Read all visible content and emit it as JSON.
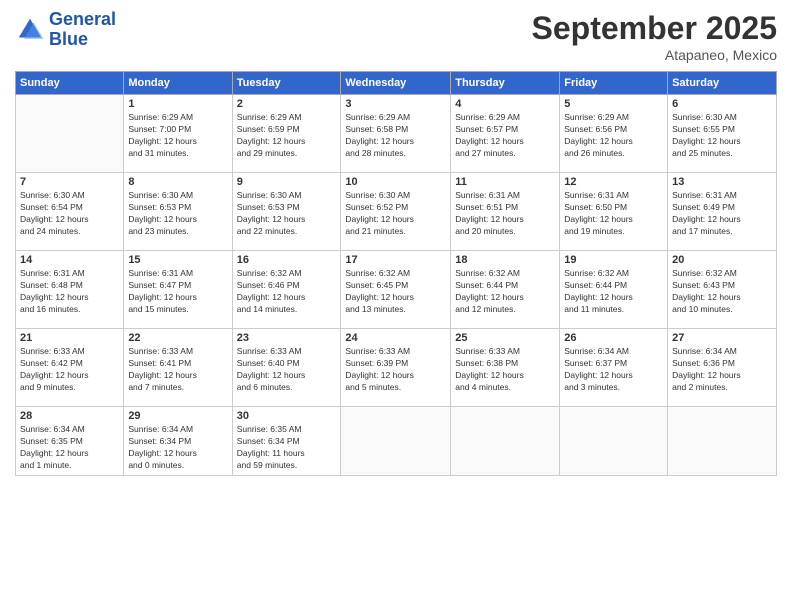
{
  "logo": {
    "line1": "General",
    "line2": "Blue"
  },
  "title": "September 2025",
  "subtitle": "Atapaneo, Mexico",
  "days_of_week": [
    "Sunday",
    "Monday",
    "Tuesday",
    "Wednesday",
    "Thursday",
    "Friday",
    "Saturday"
  ],
  "weeks": [
    [
      {
        "day": "",
        "info": ""
      },
      {
        "day": "1",
        "info": "Sunrise: 6:29 AM\nSunset: 7:00 PM\nDaylight: 12 hours\nand 31 minutes."
      },
      {
        "day": "2",
        "info": "Sunrise: 6:29 AM\nSunset: 6:59 PM\nDaylight: 12 hours\nand 29 minutes."
      },
      {
        "day": "3",
        "info": "Sunrise: 6:29 AM\nSunset: 6:58 PM\nDaylight: 12 hours\nand 28 minutes."
      },
      {
        "day": "4",
        "info": "Sunrise: 6:29 AM\nSunset: 6:57 PM\nDaylight: 12 hours\nand 27 minutes."
      },
      {
        "day": "5",
        "info": "Sunrise: 6:29 AM\nSunset: 6:56 PM\nDaylight: 12 hours\nand 26 minutes."
      },
      {
        "day": "6",
        "info": "Sunrise: 6:30 AM\nSunset: 6:55 PM\nDaylight: 12 hours\nand 25 minutes."
      }
    ],
    [
      {
        "day": "7",
        "info": "Sunrise: 6:30 AM\nSunset: 6:54 PM\nDaylight: 12 hours\nand 24 minutes."
      },
      {
        "day": "8",
        "info": "Sunrise: 6:30 AM\nSunset: 6:53 PM\nDaylight: 12 hours\nand 23 minutes."
      },
      {
        "day": "9",
        "info": "Sunrise: 6:30 AM\nSunset: 6:53 PM\nDaylight: 12 hours\nand 22 minutes."
      },
      {
        "day": "10",
        "info": "Sunrise: 6:30 AM\nSunset: 6:52 PM\nDaylight: 12 hours\nand 21 minutes."
      },
      {
        "day": "11",
        "info": "Sunrise: 6:31 AM\nSunset: 6:51 PM\nDaylight: 12 hours\nand 20 minutes."
      },
      {
        "day": "12",
        "info": "Sunrise: 6:31 AM\nSunset: 6:50 PM\nDaylight: 12 hours\nand 19 minutes."
      },
      {
        "day": "13",
        "info": "Sunrise: 6:31 AM\nSunset: 6:49 PM\nDaylight: 12 hours\nand 17 minutes."
      }
    ],
    [
      {
        "day": "14",
        "info": "Sunrise: 6:31 AM\nSunset: 6:48 PM\nDaylight: 12 hours\nand 16 minutes."
      },
      {
        "day": "15",
        "info": "Sunrise: 6:31 AM\nSunset: 6:47 PM\nDaylight: 12 hours\nand 15 minutes."
      },
      {
        "day": "16",
        "info": "Sunrise: 6:32 AM\nSunset: 6:46 PM\nDaylight: 12 hours\nand 14 minutes."
      },
      {
        "day": "17",
        "info": "Sunrise: 6:32 AM\nSunset: 6:45 PM\nDaylight: 12 hours\nand 13 minutes."
      },
      {
        "day": "18",
        "info": "Sunrise: 6:32 AM\nSunset: 6:44 PM\nDaylight: 12 hours\nand 12 minutes."
      },
      {
        "day": "19",
        "info": "Sunrise: 6:32 AM\nSunset: 6:44 PM\nDaylight: 12 hours\nand 11 minutes."
      },
      {
        "day": "20",
        "info": "Sunrise: 6:32 AM\nSunset: 6:43 PM\nDaylight: 12 hours\nand 10 minutes."
      }
    ],
    [
      {
        "day": "21",
        "info": "Sunrise: 6:33 AM\nSunset: 6:42 PM\nDaylight: 12 hours\nand 9 minutes."
      },
      {
        "day": "22",
        "info": "Sunrise: 6:33 AM\nSunset: 6:41 PM\nDaylight: 12 hours\nand 7 minutes."
      },
      {
        "day": "23",
        "info": "Sunrise: 6:33 AM\nSunset: 6:40 PM\nDaylight: 12 hours\nand 6 minutes."
      },
      {
        "day": "24",
        "info": "Sunrise: 6:33 AM\nSunset: 6:39 PM\nDaylight: 12 hours\nand 5 minutes."
      },
      {
        "day": "25",
        "info": "Sunrise: 6:33 AM\nSunset: 6:38 PM\nDaylight: 12 hours\nand 4 minutes."
      },
      {
        "day": "26",
        "info": "Sunrise: 6:34 AM\nSunset: 6:37 PM\nDaylight: 12 hours\nand 3 minutes."
      },
      {
        "day": "27",
        "info": "Sunrise: 6:34 AM\nSunset: 6:36 PM\nDaylight: 12 hours\nand 2 minutes."
      }
    ],
    [
      {
        "day": "28",
        "info": "Sunrise: 6:34 AM\nSunset: 6:35 PM\nDaylight: 12 hours\nand 1 minute."
      },
      {
        "day": "29",
        "info": "Sunrise: 6:34 AM\nSunset: 6:34 PM\nDaylight: 12 hours\nand 0 minutes."
      },
      {
        "day": "30",
        "info": "Sunrise: 6:35 AM\nSunset: 6:34 PM\nDaylight: 11 hours\nand 59 minutes."
      },
      {
        "day": "",
        "info": ""
      },
      {
        "day": "",
        "info": ""
      },
      {
        "day": "",
        "info": ""
      },
      {
        "day": "",
        "info": ""
      }
    ]
  ]
}
